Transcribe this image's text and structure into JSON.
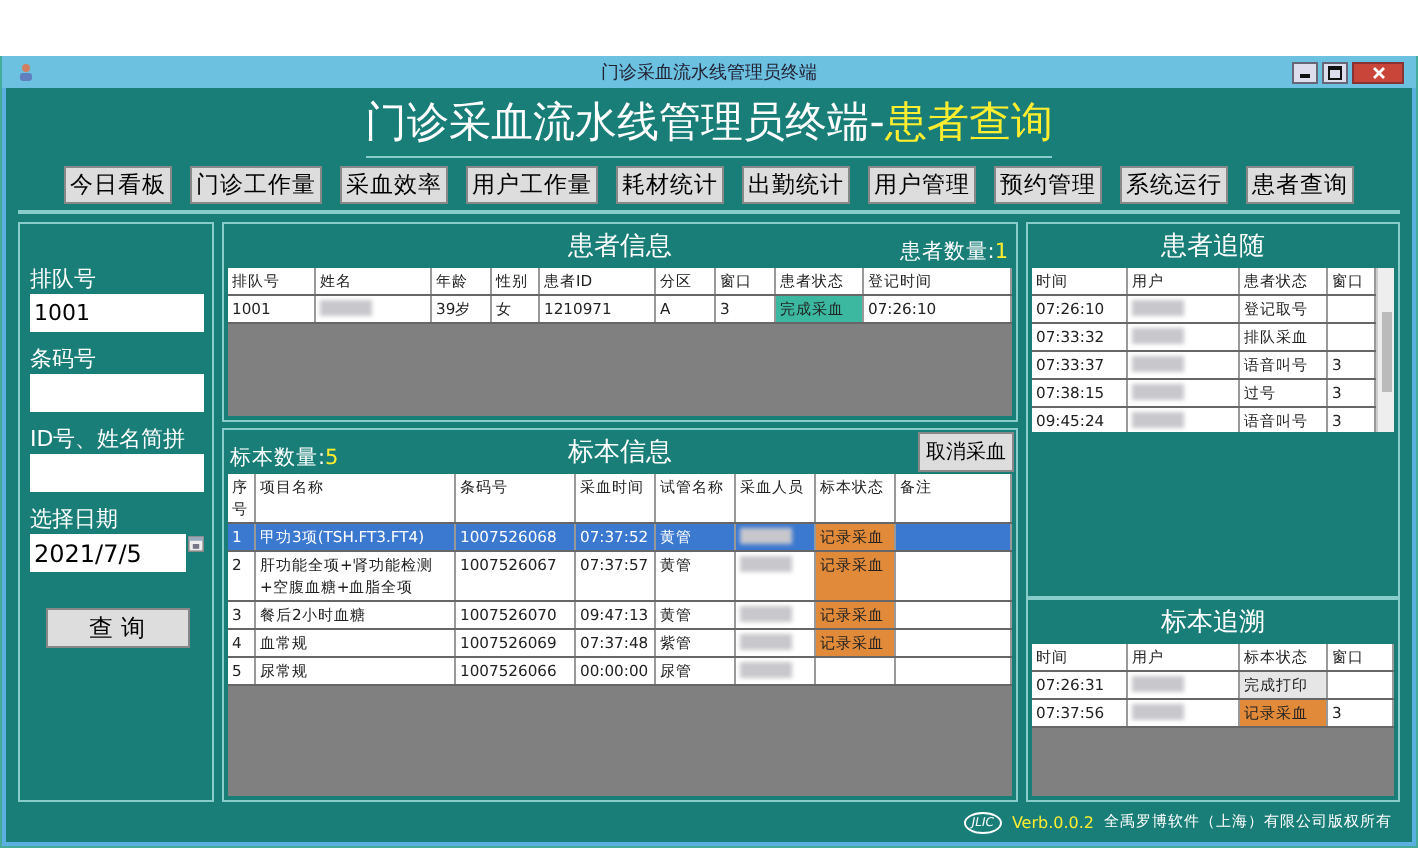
{
  "window": {
    "title": "门诊采血流水线管理员终端"
  },
  "header": {
    "title": "门诊采血流水线管理员终端-",
    "highlight": "患者查询"
  },
  "nav": [
    "今日看板",
    "门诊工作量",
    "采血效率",
    "用户工作量",
    "耗材统计",
    "出勤统计",
    "用户管理",
    "预约管理",
    "系统运行",
    "患者查询"
  ],
  "search": {
    "fields": [
      {
        "label": "排队号",
        "value": "1001"
      },
      {
        "label": "条码号"
      },
      {
        "label": "ID号、姓名简拼"
      }
    ],
    "date": {
      "label": "选择日期",
      "value": "2021/7/5"
    },
    "button": "查 询"
  },
  "patient_info": {
    "title": "患者信息",
    "count_label": "患者数量:",
    "count": "1",
    "columns": [
      {
        "label": "排队号",
        "kind": "text"
      },
      {
        "label": "姓名",
        "kind": "blurred"
      },
      {
        "label": "年龄",
        "kind": "text"
      },
      {
        "label": "性别",
        "kind": "text"
      },
      {
        "label": "患者ID",
        "kind": "text"
      },
      {
        "label": "分区",
        "kind": "text"
      },
      {
        "label": "窗口",
        "kind": "text"
      },
      {
        "label": "患者状态",
        "kind": "status"
      },
      {
        "label": "登记时间",
        "kind": "text"
      }
    ],
    "rows": [
      {
        "cells": [
          "1001",
          null,
          "39岁",
          "女",
          "1210971",
          "A",
          "3",
          {
            "text": "完成采血",
            "color": "#3cb8a0"
          },
          "07:26:10"
        ]
      }
    ]
  },
  "specimen_info": {
    "title": "标本信息",
    "count_label": "标本数量:",
    "count": "5",
    "cancel_button": "取消采血",
    "columns": [
      {
        "label": "序号",
        "kind": "text"
      },
      {
        "label": "项目名称",
        "kind": "text"
      },
      {
        "label": "条码号",
        "kind": "text"
      },
      {
        "label": "采血时间",
        "kind": "text"
      },
      {
        "label": "试管名称",
        "kind": "text"
      },
      {
        "label": "采血人员",
        "kind": "blurred"
      },
      {
        "label": "标本状态",
        "kind": "status"
      },
      {
        "label": "备注",
        "kind": "text"
      }
    ],
    "rows": [
      {
        "selected": true,
        "cells": [
          "1",
          "甲功3项(TSH.FT3.FT4)",
          "1007526068",
          "07:37:52",
          "黄管",
          null,
          {
            "text": "记录采血",
            "color": "#e08a3a"
          },
          null
        ]
      },
      {
        "selected": false,
        "cells": [
          "2",
          "肝功能全项+肾功能检测+空腹血糖+血脂全项",
          "1007526067",
          "07:37:57",
          "黄管",
          null,
          {
            "text": "记录采血",
            "color": "#e08a3a"
          },
          null
        ]
      },
      {
        "selected": false,
        "cells": [
          "3",
          "餐后2小时血糖",
          "1007526070",
          "09:47:13",
          "黄管",
          null,
          {
            "text": "记录采血",
            "color": "#e08a3a"
          },
          null
        ]
      },
      {
        "selected": false,
        "cells": [
          "4",
          "血常规",
          "1007526069",
          "07:37:48",
          "紫管",
          null,
          {
            "text": "记录采血",
            "color": "#e08a3a"
          },
          null
        ]
      },
      {
        "selected": false,
        "cells": [
          "5",
          "尿常规",
          "1007526066",
          "00:00:00",
          "尿管",
          null,
          null,
          null
        ]
      }
    ]
  },
  "patient_trace": {
    "title": "患者追随",
    "columns": [
      {
        "label": "时间",
        "kind": "text"
      },
      {
        "label": "用户",
        "kind": "blurred"
      },
      {
        "label": "患者状态",
        "kind": "status"
      },
      {
        "label": "窗口",
        "kind": "text"
      }
    ],
    "rows": [
      {
        "cells": [
          "07:26:10",
          null,
          {
            "text": "登记取号",
            "color": "#ffffff"
          },
          null
        ]
      },
      {
        "cells": [
          "07:33:32",
          null,
          {
            "text": "排队采血",
            "color": "#ffffff"
          },
          null
        ]
      },
      {
        "cells": [
          "07:33:37",
          null,
          {
            "text": "语音叫号",
            "color": "#ffffff"
          },
          "3"
        ]
      },
      {
        "cells": [
          "07:38:15",
          null,
          {
            "text": "过号",
            "color": "#ffffff"
          },
          "3"
        ]
      },
      {
        "cells": [
          "09:45:24",
          null,
          {
            "text": "语音叫号",
            "color": "#ffffff"
          },
          "3"
        ]
      }
    ]
  },
  "specimen_trace": {
    "title": "标本追溯",
    "columns": [
      {
        "label": "时间",
        "kind": "text"
      },
      {
        "label": "用户",
        "kind": "blurred"
      },
      {
        "label": "标本状态",
        "kind": "status"
      },
      {
        "label": "窗口",
        "kind": "text"
      }
    ],
    "rows": [
      {
        "cells": [
          "07:26:31",
          null,
          {
            "text": "完成打印",
            "color": "#e6e6e6"
          },
          null
        ]
      },
      {
        "cells": [
          "07:37:56",
          null,
          {
            "text": "记录采血",
            "color": "#e08a3a"
          },
          "3"
        ]
      }
    ]
  },
  "footer": {
    "logo": "JLIC",
    "version": "Verb.0.0.2",
    "copyright": "全禹罗博软件（上海）有限公司版权所有"
  }
}
